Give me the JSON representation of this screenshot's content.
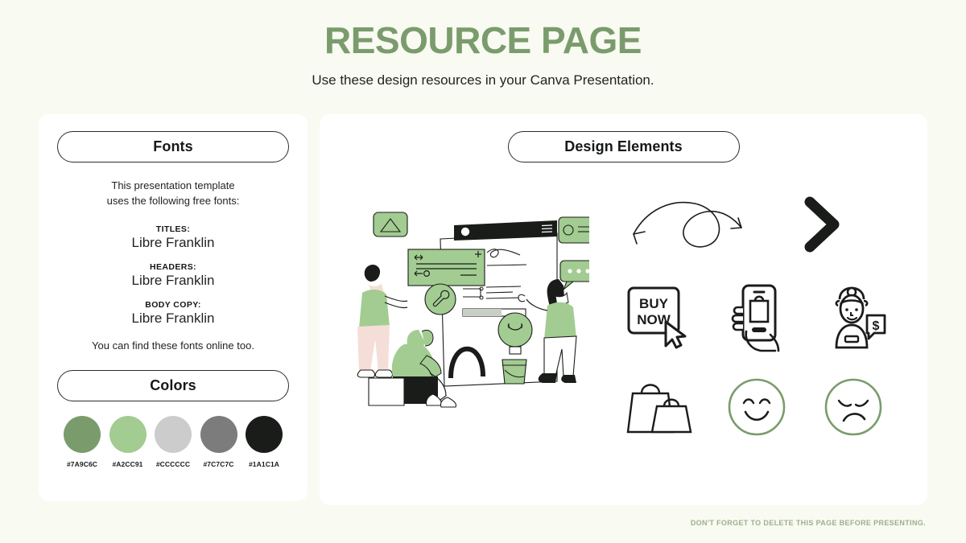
{
  "header": {
    "title": "RESOURCE PAGE",
    "subtitle": "Use these design resources in your Canva Presentation."
  },
  "fonts_panel": {
    "heading": "Fonts",
    "intro": "This presentation template\nuses the following free fonts:",
    "groups": [
      {
        "label": "TITLES:",
        "value": "Libre Franklin"
      },
      {
        "label": "HEADERS:",
        "value": "Libre Franklin"
      },
      {
        "label": "BODY COPY:",
        "value": "Libre Franklin"
      }
    ],
    "outro": "You can find these fonts online too."
  },
  "colors_panel": {
    "heading": "Colors",
    "swatches": [
      {
        "hex": "#7A9C6C"
      },
      {
        "hex": "#A2CC91"
      },
      {
        "hex": "#CCCCCC"
      },
      {
        "hex": "#7C7C7C"
      },
      {
        "hex": "#1A1C1A"
      }
    ]
  },
  "elements_panel": {
    "heading": "Design Elements",
    "illustration_name": "web-design-team-illustration",
    "icons": [
      {
        "name": "curly-arrow-icon"
      },
      {
        "name": "chevron-right-icon"
      },
      {
        "name": "buy-now-button-icon"
      },
      {
        "name": "hand-holding-phone-shopping-icon"
      },
      {
        "name": "cashier-dollar-speech-icon"
      },
      {
        "name": "shopping-bags-icon"
      },
      {
        "name": "happy-face-icon"
      },
      {
        "name": "sad-face-icon"
      }
    ],
    "icon_text": {
      "buy": "BUY",
      "now": "NOW",
      "dollar": "$"
    }
  },
  "footer": {
    "note": "DON'T FORGET TO DELETE THIS PAGE BEFORE PRESENTING."
  },
  "theme": {
    "background": "#F9FAF2",
    "card": "#FFFFFF",
    "accent_green": "#7A9C6C",
    "light_green": "#A2CC91",
    "dark": "#1A1C1A",
    "footer_text": "#9BB08D"
  }
}
